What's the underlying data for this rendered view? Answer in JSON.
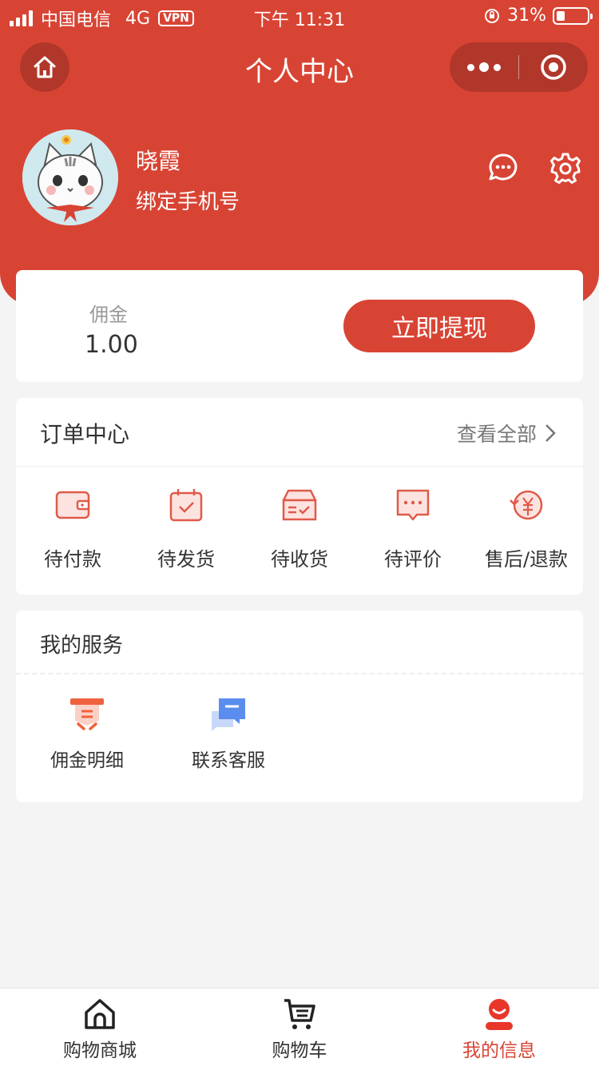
{
  "status_bar": {
    "carrier": "中国电信",
    "network": "4G",
    "vpn": "VPN",
    "time": "下午 11:31",
    "battery": "31%"
  },
  "nav": {
    "title": "个人中心"
  },
  "profile": {
    "name": "晓霞",
    "bind_phone": "绑定手机号"
  },
  "commission": {
    "label": "佣金",
    "value": "1.00",
    "withdraw_label": "立即提现"
  },
  "orders": {
    "title": "订单中心",
    "view_all": "查看全部",
    "items": [
      {
        "label": "待付款",
        "icon": "wallet-icon"
      },
      {
        "label": "待发货",
        "icon": "calendar-check-icon"
      },
      {
        "label": "待收货",
        "icon": "box-icon"
      },
      {
        "label": "待评价",
        "icon": "comment-icon"
      },
      {
        "label": "售后/退款",
        "icon": "refund-icon"
      }
    ]
  },
  "services": {
    "title": "我的服务",
    "items": [
      {
        "label": "佣金明细",
        "icon": "commission-detail-icon"
      },
      {
        "label": "联系客服",
        "icon": "customer-service-icon"
      }
    ]
  },
  "tabbar": {
    "items": [
      {
        "label": "购物商城",
        "icon": "home-icon",
        "active": false
      },
      {
        "label": "购物车",
        "icon": "cart-icon",
        "active": false
      },
      {
        "label": "我的信息",
        "icon": "user-icon",
        "active": true
      }
    ]
  },
  "colors": {
    "primary": "#d84434",
    "background": "#f4f4f4",
    "service_accent": "#f0623f",
    "service_blue": "#5b8def"
  }
}
